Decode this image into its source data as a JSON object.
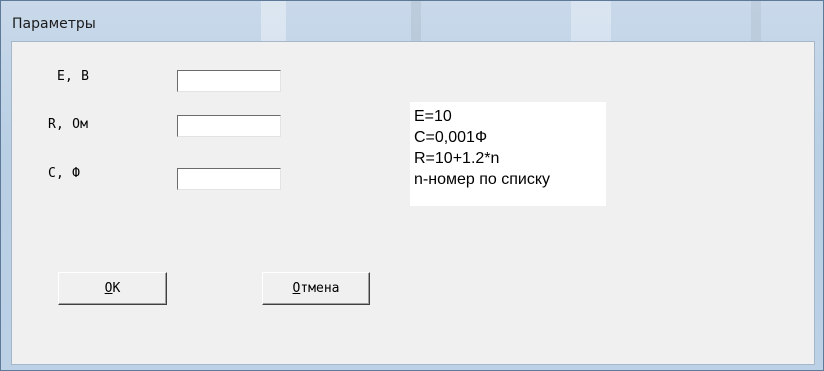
{
  "window": {
    "title": "Параметры"
  },
  "form": {
    "e_label": "E, B",
    "r_label": "R, Ом",
    "c_label": "C, Ф",
    "e_value": "",
    "r_value": "",
    "c_value": ""
  },
  "info": {
    "lines": [
      "E=10",
      "C=0,001Ф",
      "R=10+1.2*n",
      "n-номер по списку"
    ]
  },
  "buttons": {
    "ok_mnemonic": "O",
    "ok_rest": "K",
    "cancel_mnemonic": "О",
    "cancel_rest": "тмена"
  }
}
